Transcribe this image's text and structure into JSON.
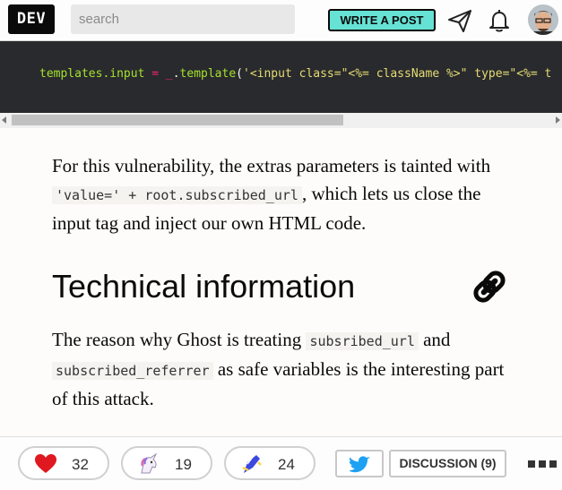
{
  "header": {
    "logo_text": "DEV",
    "search_placeholder": "search",
    "write_post_label": "WRITE A POST",
    "icons": [
      "paper-plane-icon",
      "bell-icon",
      "avatar"
    ]
  },
  "code_block": {
    "tokens": [
      {
        "text": "templates.input",
        "kind": "var"
      },
      {
        "text": " ",
        "kind": "plain"
      },
      {
        "text": "=",
        "kind": "op"
      },
      {
        "text": " ",
        "kind": "plain"
      },
      {
        "text": "_",
        "kind": "op"
      },
      {
        "text": ".",
        "kind": "plain"
      },
      {
        "text": "template",
        "kind": "var"
      },
      {
        "text": "(",
        "kind": "plain"
      },
      {
        "text": "'<input class=\"<%= className %>\" type=\"<%= t",
        "kind": "str"
      }
    ]
  },
  "article": {
    "para1": {
      "before": "For this vulnerability, the extras parameters is tainted with ",
      "code": "'value=' + root.subscribed_url",
      "after": ", which lets us close the input tag and inject our own HTML code."
    },
    "heading": "Technical information",
    "para2": {
      "before": "The reason why Ghost is treating ",
      "code1": "subsribed_url",
      "middle": " and ",
      "code2": "subscribed_referrer",
      "after": " as safe variables is the interesting part of this attack."
    }
  },
  "reactions": {
    "likes": "32",
    "unicorns": "19",
    "bookmarks": "24"
  },
  "discussion_label": "DISCUSSION (9)",
  "colors": {
    "accent": "#66e2d5",
    "heart": "#e0181f",
    "twitter": "#1da1f2",
    "code_bg": "#292a2d"
  }
}
